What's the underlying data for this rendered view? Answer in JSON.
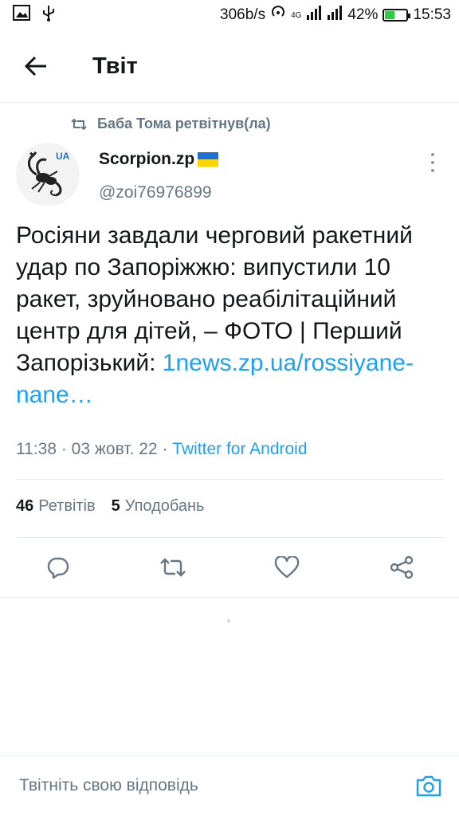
{
  "status_bar": {
    "speed": "306b/s",
    "network": "4G",
    "battery": "42%",
    "battery_level": 0.42,
    "time": "15:53"
  },
  "header": {
    "title": "Твіт"
  },
  "retweet": {
    "text": "Баба Тома ретвітнув(ла)"
  },
  "tweet": {
    "author_name": "Scorpion.zp",
    "author_handle": "@zoi76976899",
    "avatar_badge": "UA",
    "text": "Росіяни завдали черговий ракетний удар по Запоріжжю: випустили 10 ракет, зруйновано реабілітаційний центр для дітей, – ФОТО | Перший Запорізький:",
    "link": "1news.zp.ua/rossiyane-nane…",
    "time": "11:38",
    "date": "03 жовт. 22",
    "client": "Twitter for Android"
  },
  "stats": {
    "retweets_count": "46",
    "retweets_label": "Ретвітів",
    "likes_count": "5",
    "likes_label": "Уподобань"
  },
  "reply": {
    "placeholder": "Твітніть свою відповідь"
  },
  "colors": {
    "accent": "#1da1f2",
    "muted": "#657786",
    "divider": "#e6ecf0"
  }
}
